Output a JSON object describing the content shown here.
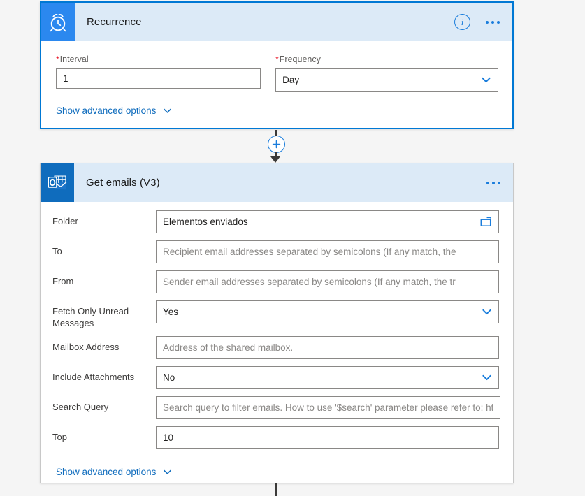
{
  "page": {
    "background_color": "#f5f5f5",
    "accent_color": "#0078d4"
  },
  "recurrence_card": {
    "title": "Recurrence",
    "icon": "alarm-clock-icon",
    "icon_background": "#2b88ef",
    "header_background": "#dceaf7",
    "selected": true,
    "actions": {
      "info": "info-icon",
      "more": "more-options-icon"
    },
    "fields": [
      {
        "label": "Interval",
        "required": true,
        "value": "1",
        "is_placeholder": false,
        "type": "text"
      },
      {
        "label": "Frequency",
        "required": true,
        "value": "Day",
        "is_placeholder": false,
        "type": "dropdown"
      }
    ],
    "advanced_link": "Show advanced options"
  },
  "get_emails_card": {
    "title": "Get emails (V3)",
    "icon": "outlook-icon",
    "icon_background": "#0f6cbd",
    "header_background": "#dceaf7",
    "selected": false,
    "actions": {
      "more": "more-options-icon"
    },
    "fields": [
      {
        "label": "Folder",
        "value": "Elementos enviados",
        "is_placeholder": false,
        "type": "picker",
        "trailing_icon": "folder-icon"
      },
      {
        "label": "To",
        "value": "Recipient email addresses separated by semicolons (If any match, the",
        "is_placeholder": true,
        "type": "text"
      },
      {
        "label": "From",
        "value": "Sender email addresses separated by semicolons (If any match, the tr",
        "is_placeholder": true,
        "type": "text"
      },
      {
        "label": "Fetch Only Unread Messages",
        "value": "Yes",
        "is_placeholder": false,
        "type": "dropdown"
      },
      {
        "label": "Mailbox Address",
        "value": "Address of the shared mailbox.",
        "is_placeholder": true,
        "type": "text"
      },
      {
        "label": "Include Attachments",
        "value": "No",
        "is_placeholder": false,
        "type": "dropdown"
      },
      {
        "label": "Search Query",
        "value": "Search query to filter emails. How to use '$search' parameter please refer to: ht",
        "is_placeholder": true,
        "type": "text"
      },
      {
        "label": "Top",
        "value": "10",
        "is_placeholder": false,
        "type": "text"
      }
    ],
    "advanced_link": "Show advanced options"
  },
  "connector": {
    "add_step": "add-step-button",
    "symbol": "+"
  }
}
